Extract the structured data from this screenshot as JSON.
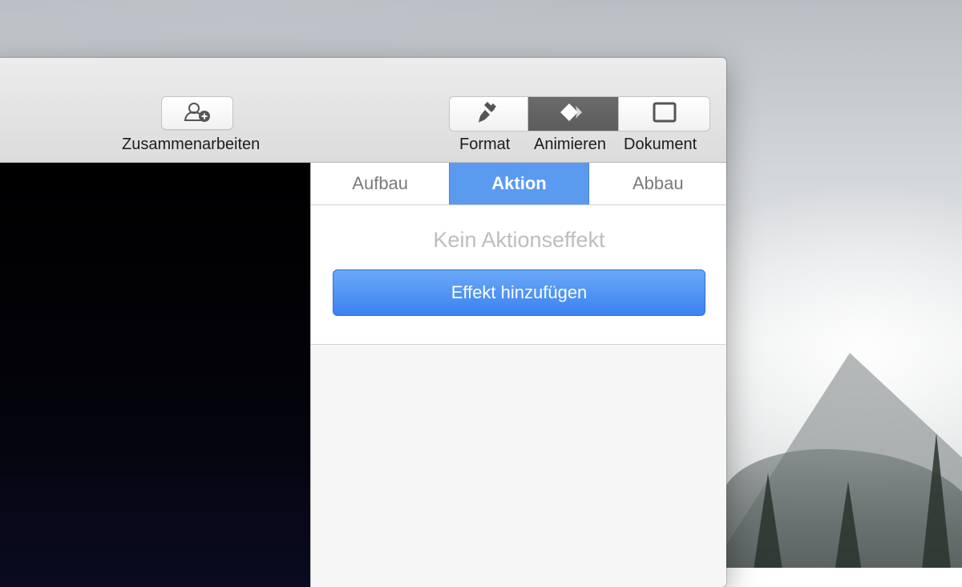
{
  "toolbar": {
    "collaborate": {
      "label": "Zusammenarbeiten",
      "icon": "add-person-icon"
    },
    "segments": [
      {
        "label": "Format",
        "icon": "paintbrush-icon",
        "active": false
      },
      {
        "label": "Animieren",
        "icon": "animate-diamonds-icon",
        "active": true
      },
      {
        "label": "Dokument",
        "icon": "document-icon",
        "active": false
      }
    ]
  },
  "inspector": {
    "tabs": [
      {
        "label": "Aufbau",
        "active": false
      },
      {
        "label": "Aktion",
        "active": true
      },
      {
        "label": "Abbau",
        "active": false
      }
    ],
    "empty_message": "Kein Aktionseffekt",
    "add_effect_label": "Effekt hinzufügen"
  },
  "colors": {
    "accent": "#5a9bf0",
    "button_blue": "#3a82f0",
    "segment_active": "#5c5c5c"
  }
}
